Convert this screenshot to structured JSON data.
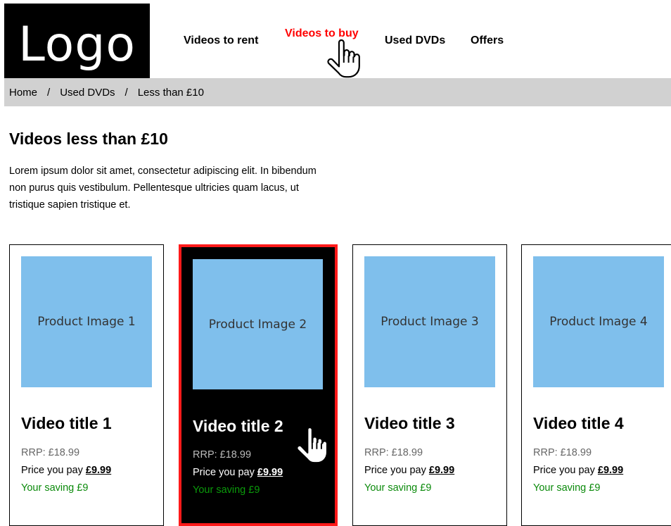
{
  "header": {
    "logo_text": "Logo",
    "nav": [
      {
        "label": "Videos to rent"
      },
      {
        "label": "Videos to buy",
        "active": true
      },
      {
        "label": "Used DVDs"
      },
      {
        "label": "Offers"
      }
    ]
  },
  "breadcrumb": {
    "items": [
      "Home",
      "Used DVDs",
      "Less than £10"
    ],
    "separator": "/"
  },
  "main": {
    "title": "Videos less than £10",
    "intro": "Lorem ipsum dolor sit amet, consectetur adipiscing elit. In bibendum non purus quis vestibulum. Pellentesque ultricies quam lacus, ut tristique sapien tristique et."
  },
  "products": [
    {
      "image_label": "Product Image 1",
      "title": "Video title 1",
      "rrp": "RRP: £18.99",
      "pay_label": "Price you pay",
      "price": "£9.99",
      "saving": "Your saving £9"
    },
    {
      "image_label": "Product Image 2",
      "title": "Video title 2",
      "rrp": "RRP: £18.99",
      "pay_label": "Price you pay",
      "price": "£9.99",
      "saving": "Your saving £9",
      "selected": true
    },
    {
      "image_label": "Product Image 3",
      "title": "Video title 3",
      "rrp": "RRP: £18.99",
      "pay_label": "Price you pay",
      "price": "£9.99",
      "saving": "Your saving £9"
    },
    {
      "image_label": "Product Image 4",
      "title": "Video title 4",
      "rrp": "RRP: £18.99",
      "pay_label": "Price you pay",
      "price": "£9.99",
      "saving": "Your saving £9"
    }
  ],
  "colors": {
    "accent": "#ff0000",
    "image_placeholder": "#7fbfec",
    "saving": "#0b8a0b",
    "breadcrumb_bg": "#d1d1d1"
  },
  "icons": [
    "hand-pointer-cursor-icon"
  ]
}
